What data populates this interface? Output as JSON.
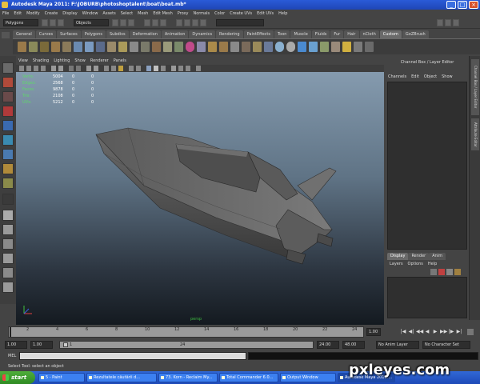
{
  "window": {
    "title": "Autodesk Maya 2011: F:\\JOBURB\\photoshoptalent\\boat\\boat.mb*",
    "minimize": "_",
    "maximize": "□",
    "close": "×"
  },
  "menubar": [
    "File",
    "Edit",
    "Modify",
    "Create",
    "Display",
    "Window",
    "Assets",
    "Select",
    "Mesh",
    "Edit Mesh",
    "Proxy",
    "Normals",
    "Color",
    "Create UVs",
    "Edit UVs",
    "Help"
  ],
  "statusline": {
    "mode": "Polygons",
    "object_field": "Objects"
  },
  "shelf_tabs": [
    "General",
    "Curves",
    "Surfaces",
    "Polygons",
    "Subdivs",
    "Deformation",
    "Animation",
    "Dynamics",
    "Rendering",
    "PaintEffects",
    "Toon",
    "Muscle",
    "Fluids",
    "Fur",
    "Hair",
    "nCloth",
    "Custom",
    "GoZBrush"
  ],
  "active_shelf_tab": "Custom",
  "panel_menu": [
    "View",
    "Shading",
    "Lighting",
    "Show",
    "Renderer",
    "Panels"
  ],
  "hud": [
    {
      "label": "Verts:",
      "values": [
        "5004",
        "0",
        "0"
      ]
    },
    {
      "label": "Edges:",
      "values": [
        "2568",
        "0",
        "0"
      ]
    },
    {
      "label": "Faces:",
      "values": [
        "9878",
        "0",
        "0"
      ]
    },
    {
      "label": "Tris:",
      "values": [
        "2108",
        "0",
        "0"
      ]
    },
    {
      "label": "UVs:",
      "values": [
        "5212",
        "0",
        "0"
      ]
    }
  ],
  "viewport_label": "persp",
  "channel_box": {
    "header": "Channel Box / Layer Editor",
    "menu": [
      "Channels",
      "Edit",
      "Object",
      "Show"
    ]
  },
  "layer_editor": {
    "tabs": [
      "Display",
      "Render",
      "Anim"
    ],
    "active_tab": "Display",
    "menu": [
      "Layers",
      "Options",
      "Help"
    ]
  },
  "side_tabs": [
    "Channel Box / Layer Editor",
    "Attribute Editor"
  ],
  "time_slider": {
    "ticks": [
      "2",
      "4",
      "6",
      "8",
      "10",
      "12",
      "14",
      "16",
      "18",
      "20",
      "22",
      "24"
    ],
    "current_frame": "1.00",
    "playback": [
      "|◀",
      "◀|",
      "◀◀",
      "◀",
      "▶",
      "▶▶",
      "|▶",
      "▶|"
    ]
  },
  "range_slider": {
    "start": "1.00",
    "inner_start": "1.00",
    "inner_start_bar": "1",
    "inner_end_bar": "24",
    "end": "24.00",
    "outer_end": "48.00",
    "anim_layer": "No Anim Layer",
    "char_set": "No Character Set"
  },
  "command_line": {
    "label": "MEL"
  },
  "help_line": "Select Tool: select an object",
  "taskbar": {
    "start": "start",
    "tasks": [
      {
        "label": "5 - Paint",
        "active": false
      },
      {
        "label": "Rezultatele căutării d...",
        "active": false
      },
      {
        "label": "73. Korn - Reclaim My...",
        "active": false
      },
      {
        "label": "Total Commander 6.0...",
        "active": false
      },
      {
        "label": "Output Window",
        "active": false
      },
      {
        "label": "Autodesk Maya 2011:...",
        "active": true
      }
    ]
  },
  "watermark": "pxleyes.com",
  "colors": {
    "hud_label": "#5fd86a",
    "title_bar": "#2a5bd7",
    "viewport_top": "#8aa0b4",
    "viewport_bottom": "#141a20",
    "model": "#5a5a5a"
  }
}
